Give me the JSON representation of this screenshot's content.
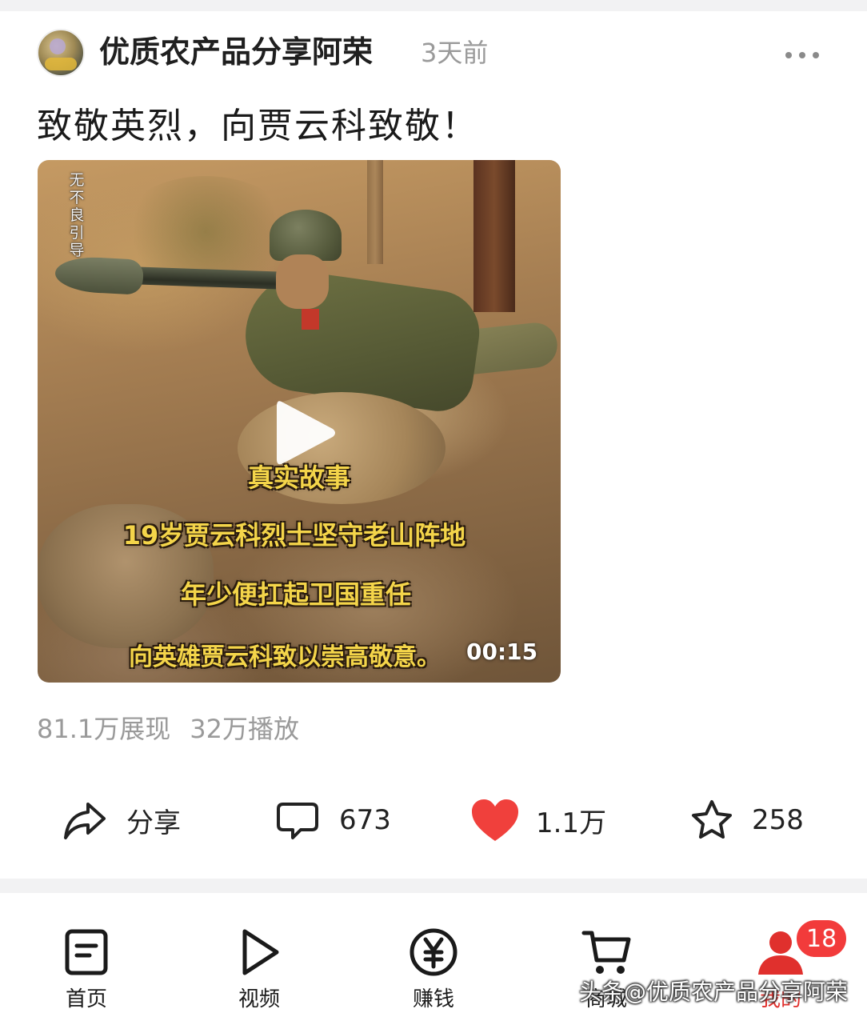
{
  "post": {
    "author": "优质农产品分享阿荣",
    "time": "3天前",
    "title": "致敬英烈，向贾云科致敬！",
    "video": {
      "side_tag": "无\n不\n良\n引\n导",
      "captions": [
        "真实故事",
        "19岁贾云科烈士坚守老山阵地",
        "年少便扛起卫国重任",
        "向英雄贾云科致以崇高敬意。"
      ],
      "duration": "00:15"
    },
    "stats": {
      "impressions": "81.1万展现",
      "plays": "32万播放"
    },
    "actions": {
      "share_label": "分享",
      "comments": "673",
      "likes": "1.1万",
      "favorites": "258",
      "like_color": "#f0403c"
    }
  },
  "tabbar": {
    "items": [
      {
        "label": "首页",
        "icon": "home-doc-icon"
      },
      {
        "label": "视频",
        "icon": "play-icon"
      },
      {
        "label": "赚钱",
        "icon": "yuan-coin-icon"
      },
      {
        "label": "商城",
        "icon": "cart-icon"
      },
      {
        "label": "我的",
        "icon": "user-icon"
      }
    ],
    "me_badge": "18",
    "active_color": "#e0302d"
  },
  "watermark": "头条@优质农产品分享阿荣"
}
